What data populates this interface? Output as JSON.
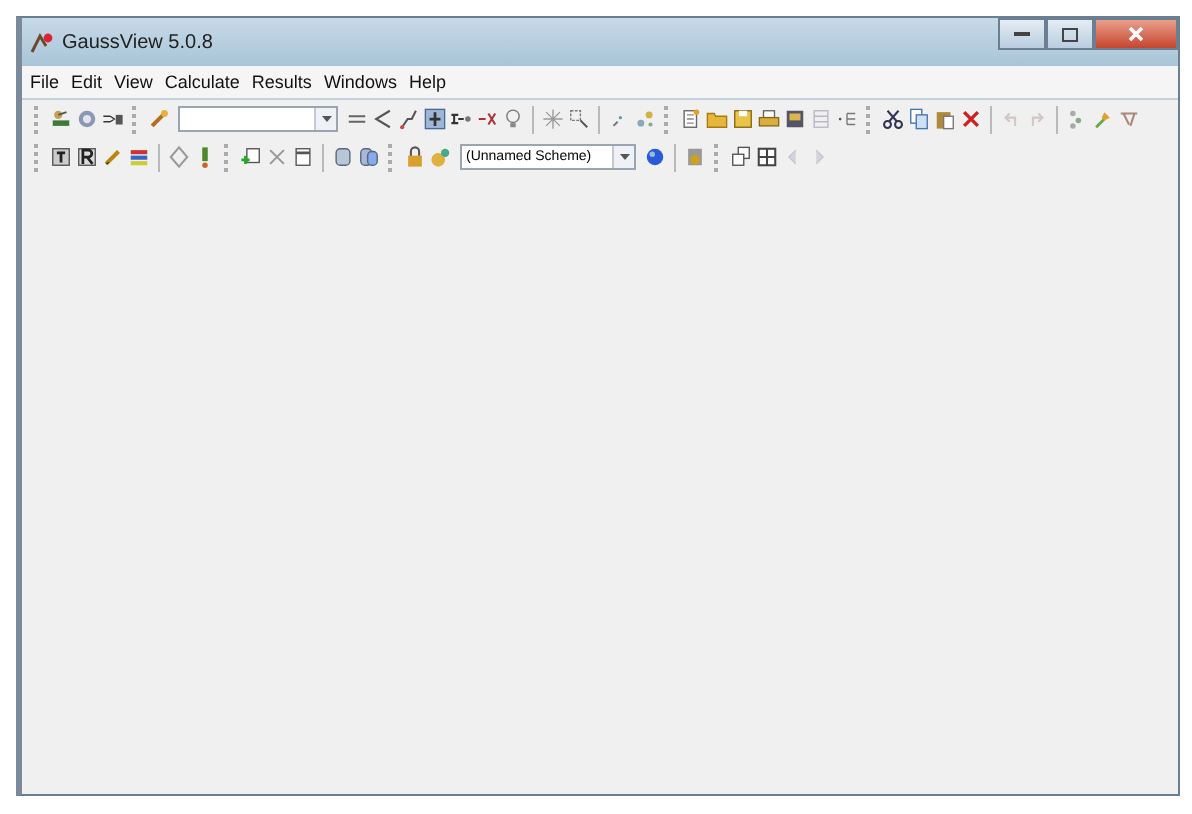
{
  "window": {
    "title": "GaussView 5.0.8"
  },
  "menu": [
    "File",
    "Edit",
    "View",
    "Calculate",
    "Results",
    "Windows",
    "Help"
  ],
  "toolbar": {
    "scheme_field": {
      "value": "(Unnamed Scheme)"
    }
  }
}
